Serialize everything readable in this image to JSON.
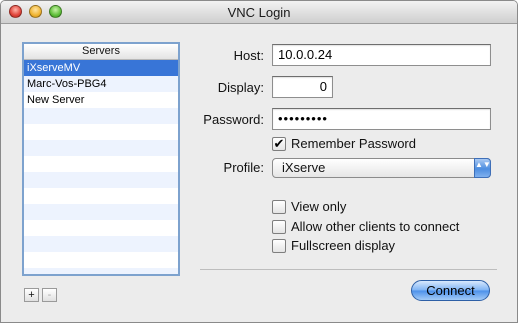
{
  "window": {
    "title": "VNC Login"
  },
  "servers": {
    "header": "Servers",
    "items": [
      {
        "label": "iXserveMV",
        "selected": true
      },
      {
        "label": "Marc-Vos-PBG4",
        "selected": false
      },
      {
        "label": "New Server",
        "selected": false
      }
    ],
    "add_label": "+",
    "remove_label": "-"
  },
  "form": {
    "host_label": "Host:",
    "host_value": "10.0.0.24",
    "display_label": "Display:",
    "display_value": "0",
    "password_label": "Password:",
    "password_value": "•••••••••",
    "remember_label": "Remember Password",
    "remember_checked": true,
    "profile_label": "Profile:",
    "profile_value": "iXserve",
    "view_only_label": "View only",
    "allow_others_label": "Allow other clients to connect",
    "fullscreen_label": "Fullscreen display",
    "check_mark": "✔",
    "select_arrows": "▲▼"
  },
  "actions": {
    "connect_label": "Connect"
  },
  "colors": {
    "selection": "#3875d7",
    "list_border": "#7da2ce",
    "accent": "#4b90ea"
  }
}
